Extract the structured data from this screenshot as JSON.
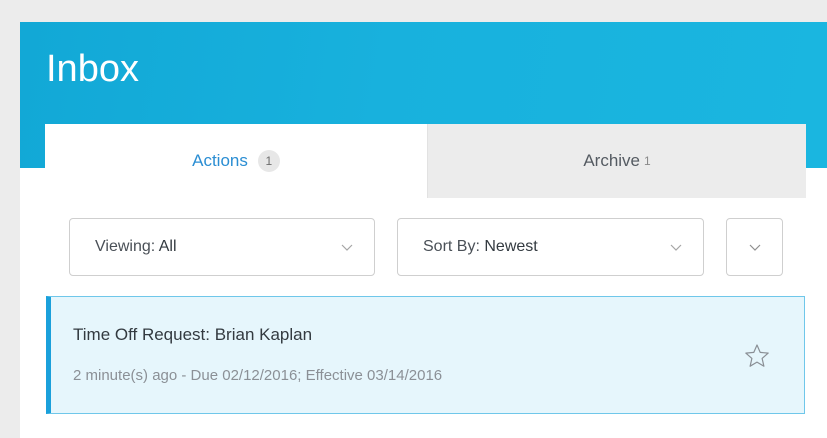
{
  "header": {
    "title": "Inbox"
  },
  "tabs": {
    "actions": {
      "label": "Actions",
      "count": "1"
    },
    "archive": {
      "label": "Archive",
      "count": "1"
    }
  },
  "filters": {
    "viewing": {
      "label": "Viewing:",
      "value": "All"
    },
    "sort": {
      "label": "Sort By:",
      "value": "Newest"
    }
  },
  "items": [
    {
      "title": "Time Off Request: Brian Kaplan",
      "subtitle": "2 minute(s) ago - Due 02/12/2016; Effective 03/14/2016",
      "icon": "star-icon"
    }
  ],
  "colors": {
    "header": "#18b1dd",
    "active_tab_text": "#2b8ed3",
    "selected_item_bg": "#e6f6fc",
    "selected_item_accent": "#1aa0db"
  }
}
